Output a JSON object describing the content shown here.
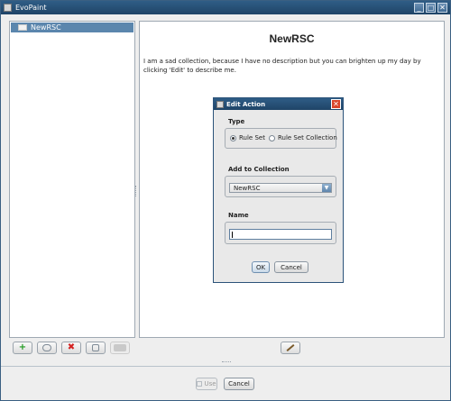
{
  "window": {
    "title": "EvoPaint",
    "controls": {
      "minimize": "_",
      "maximize": "□",
      "close": "✕"
    }
  },
  "tree": {
    "items": [
      {
        "label": "NewRSC",
        "icon": "folder-icon",
        "selected": true
      }
    ]
  },
  "collection": {
    "title": "NewRSC",
    "description": "I am a sad collection, because I have no description but you can brighten up my day by clicking 'Edit' to describe me."
  },
  "left_toolbar": {
    "buttons": [
      {
        "name": "add",
        "icon": "plus-icon",
        "glyph": "+"
      },
      {
        "name": "copy",
        "icon": "copy-icon"
      },
      {
        "name": "delete",
        "icon": "delete-icon",
        "glyph": "✖"
      },
      {
        "name": "rename",
        "icon": "rename-icon"
      },
      {
        "name": "export",
        "icon": "export-icon",
        "disabled": true
      }
    ]
  },
  "right_toolbar": {
    "edit_icon": "pencil-icon"
  },
  "bottom": {
    "use_label": "Use",
    "cancel_label": "Cancel"
  },
  "dialog": {
    "title": "Edit Action",
    "close_glyph": "✕",
    "type_label": "Type",
    "type_options": [
      "Rule Set",
      "Rule Set Collection"
    ],
    "type_selected": "Rule Set",
    "collection_label": "Add to Collection",
    "collection_value": "NewRSC",
    "name_label": "Name",
    "name_value": "",
    "ok_label": "OK",
    "cancel_label": "Cancel"
  },
  "colors": {
    "titlebar": "#1f4467",
    "selection": "#5b86ad",
    "close_button": "#d9462c"
  }
}
